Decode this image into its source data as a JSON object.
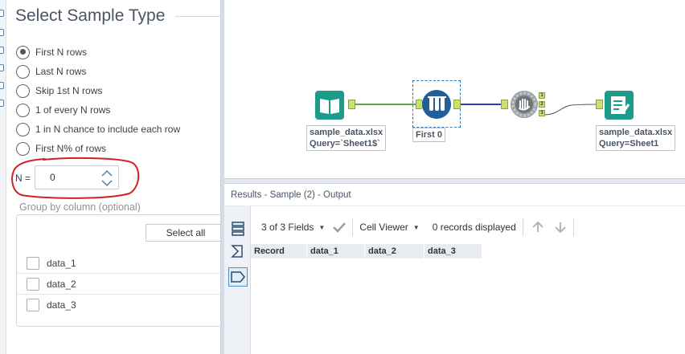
{
  "config": {
    "title": "Select Sample Type",
    "options": [
      {
        "label": "First N rows",
        "checked": true
      },
      {
        "label": "Last N rows",
        "checked": false
      },
      {
        "label": "Skip 1st N rows",
        "checked": false
      },
      {
        "label": "1 of every N rows",
        "checked": false
      },
      {
        "label": "1 in N chance to include each row",
        "checked": false
      },
      {
        "label": "First N% of rows",
        "checked": false
      }
    ],
    "n_label": "N =",
    "n_value": "0",
    "group_label": "Group by column (optional)",
    "select_all": "Select all",
    "columns": [
      "data_1",
      "data_2",
      "data_3"
    ]
  },
  "canvas": {
    "input_tool": {
      "label_line1": "sample_data.xlsx",
      "label_line2": "Query=`Sheet1$`"
    },
    "sample_tool": {
      "label": "First 0"
    },
    "output_tool": {
      "label_line1": "sample_data.xlsx",
      "label_line2": "Query=Sheet1"
    },
    "output_anchors": [
      "1",
      "2",
      "3"
    ]
  },
  "results": {
    "title": "Results - Sample (2) - Output",
    "fields": "3 of 3 Fields",
    "viewer": "Cell Viewer",
    "records": "0 records displayed",
    "headers": [
      "Record",
      "data_1",
      "data_2",
      "data_3"
    ]
  },
  "colors": {
    "accent": "#2c79b8",
    "tool_teal": "#1c9a8a",
    "tool_blue": "#1f5f9b",
    "connection_green": "#5aa84a",
    "connection_blue": "#2d3ea8",
    "annotation_red": "#d42020"
  }
}
